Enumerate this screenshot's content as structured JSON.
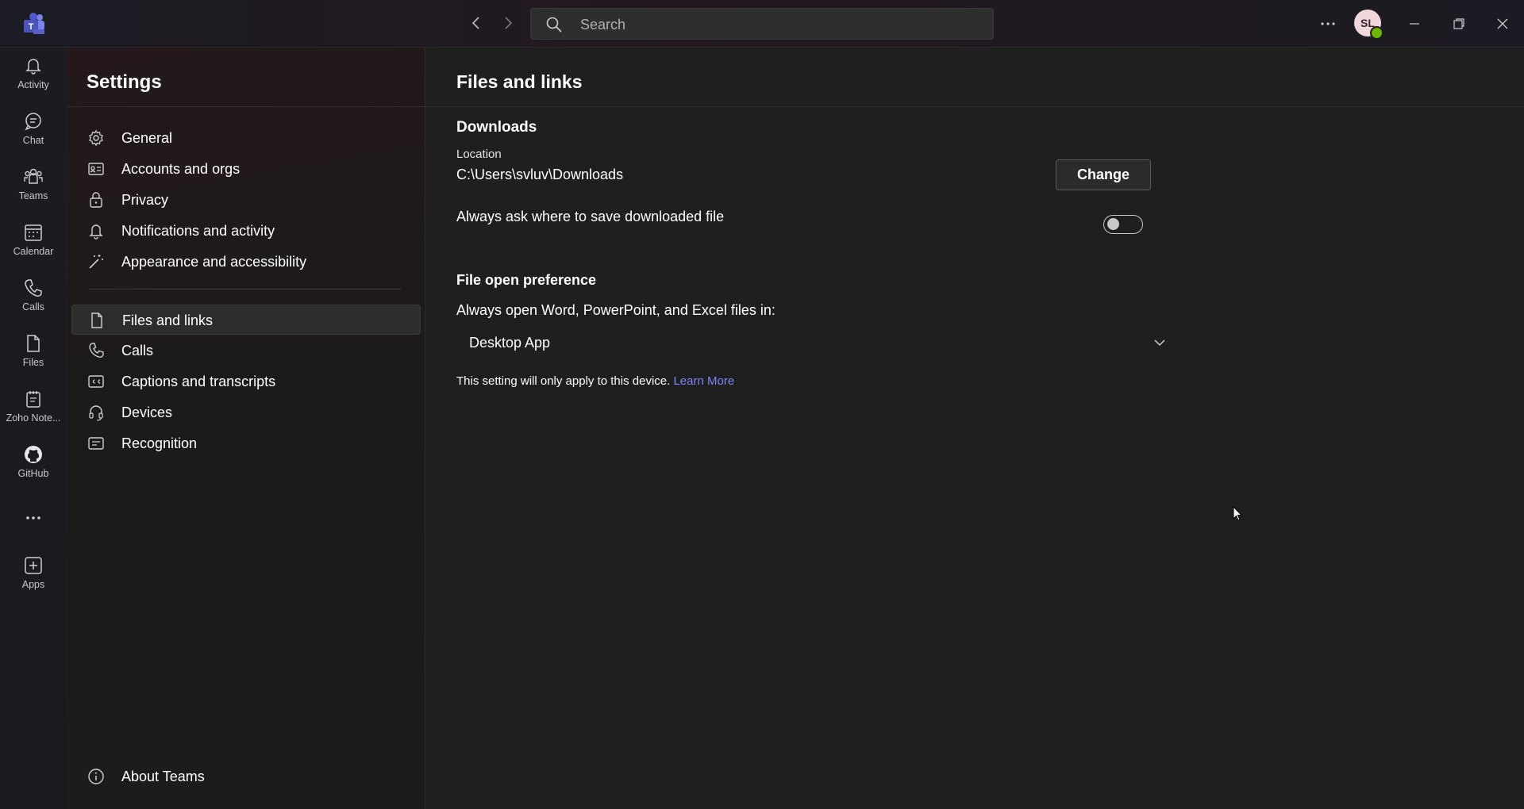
{
  "titlebar": {
    "logo_icon": "teams-logo-icon",
    "search_placeholder": "Search",
    "avatar_initials": "SL",
    "presence_color": "#6bb700"
  },
  "rail": {
    "items": [
      {
        "label": "Activity",
        "icon": "bell-icon"
      },
      {
        "label": "Chat",
        "icon": "chat-icon"
      },
      {
        "label": "Teams",
        "icon": "teams-icon"
      },
      {
        "label": "Calendar",
        "icon": "calendar-icon"
      },
      {
        "label": "Calls",
        "icon": "phone-icon"
      },
      {
        "label": "Files",
        "icon": "file-icon"
      },
      {
        "label": "Zoho Note...",
        "icon": "notebook-icon"
      },
      {
        "label": "GitHub",
        "icon": "github-icon"
      },
      {
        "label": "Apps",
        "icon": "add-app-icon"
      }
    ]
  },
  "settings": {
    "title": "Settings",
    "menu": [
      {
        "label": "General",
        "icon": "gear-icon"
      },
      {
        "label": "Accounts and orgs",
        "icon": "contact-card-icon"
      },
      {
        "label": "Privacy",
        "icon": "lock-icon"
      },
      {
        "label": "Notifications and activity",
        "icon": "bell-icon"
      },
      {
        "label": "Appearance and accessibility",
        "icon": "magic-wand-icon"
      },
      {
        "label": "Files and links",
        "icon": "file-icon",
        "active": true
      },
      {
        "label": "Calls",
        "icon": "phone-icon"
      },
      {
        "label": "Captions and transcripts",
        "icon": "closed-captions-icon"
      },
      {
        "label": "Devices",
        "icon": "headset-icon"
      },
      {
        "label": "Recognition",
        "icon": "recognition-icon"
      }
    ],
    "about": {
      "label": "About Teams",
      "icon": "info-icon"
    }
  },
  "main": {
    "title": "Files and links",
    "downloads": {
      "heading": "Downloads",
      "location_label": "Location",
      "location_value": "C:\\Users\\svluv\\Downloads",
      "change_button": "Change",
      "always_ask_label": "Always ask where to save downloaded file",
      "always_ask_enabled": false
    },
    "file_open": {
      "heading": "File open preference",
      "label": "Always open Word, PowerPoint, and Excel files in:",
      "selected": "Desktop App",
      "note": "This setting will only apply to this device.",
      "learn_more": "Learn More"
    }
  },
  "colors": {
    "accent_link": "#7f85f5",
    "background": "#1f1f1f"
  }
}
